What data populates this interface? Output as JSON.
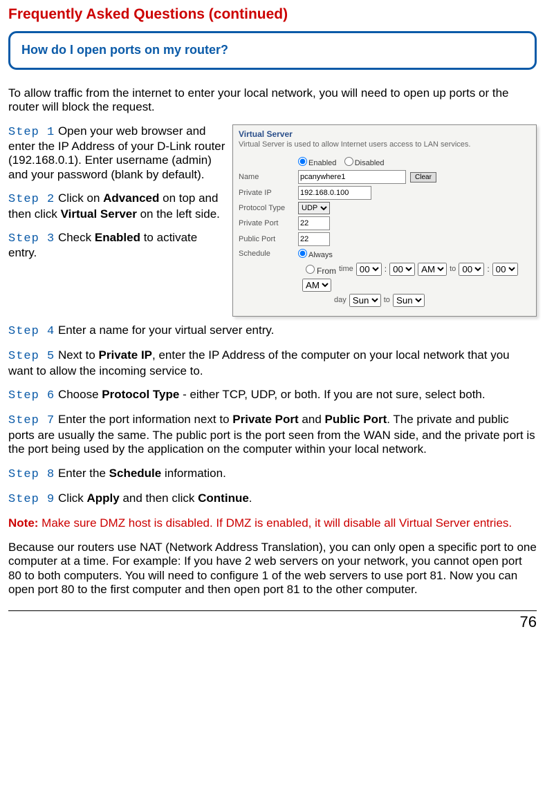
{
  "title": "Frequently Asked Questions (continued)",
  "question": "How do I open ports on my router?",
  "intro": "To allow traffic from the internet to enter your local network, you will need to open up ports or the router will block the request.",
  "steps": {
    "s1": {
      "label": "Step 1",
      "before": " Open your web browser and enter the IP Address of your D-Link router (192.168.0.1). Enter username (admin) and your password (blank by default)."
    },
    "s2": {
      "label": "Step 2",
      "t1": " Click on ",
      "b1": "Advanced",
      "t2": " on top and then click ",
      "b2": "Virtual Server",
      "t3": " on the left side."
    },
    "s3": {
      "label": "Step 3",
      "t1": " Check ",
      "b1": "Enabled",
      "t2": " to activate entry."
    },
    "s4": {
      "label": "Step 4",
      "t1": " Enter a name for your virtual server entry."
    },
    "s5": {
      "label": "Step 5",
      "t1": " Next to ",
      "b1": "Private IP",
      "t2": ", enter the IP Address of the computer on your local network that you want to allow the incoming service to."
    },
    "s6": {
      "label": "Step 6",
      "t1": " Choose ",
      "b1": "Protocol Type",
      "t2": " - either TCP, UDP, or both. If you are not sure, select both."
    },
    "s7": {
      "label": "Step 7",
      "t1": " Enter the port information next to ",
      "b1": "Private Port",
      "t2": " and ",
      "b2": "Public Port",
      "t3": ". The private and public ports are usually the same. The public port is the port seen from the WAN side, and the private port is the port being used by the application on the computer within your local network."
    },
    "s8": {
      "label": "Step 8",
      "t1": " Enter the ",
      "b1": "Schedule",
      "t2": " information."
    },
    "s9": {
      "label": "Step 9",
      "t1": " Click ",
      "b1": "Apply",
      "t2": " and then click ",
      "b2": "Continue",
      "t3": "."
    }
  },
  "note": {
    "label": "Note:",
    "body": " Make sure DMZ host is disabled. If DMZ is enabled, it will disable all Virtual Server entries."
  },
  "closing": "Because our routers use NAT (Network Address Translation), you can only open a specific port to one computer at a time. For example: If you have 2 web servers on your network, you cannot open port 80 to both computers. You will need to configure 1 of the web servers to use port 81. Now you can open port 80 to the first computer and then open port 81 to the other computer.",
  "page_number": "76",
  "screenshot": {
    "title": "Virtual Server",
    "subtitle": "Virtual Server is used to allow Internet users access to LAN services.",
    "enabled_label": "Enabled",
    "disabled_label": "Disabled",
    "name_label": "Name",
    "name_value": "pcanywhere1",
    "clear_btn": "Clear",
    "private_ip_label": "Private IP",
    "private_ip_value": "192.168.0.100",
    "protocol_label": "Protocol Type",
    "protocol_value": "UDP",
    "private_port_label": "Private Port",
    "private_port_value": "22",
    "public_port_label": "Public Port",
    "public_port_value": "22",
    "schedule_label": "Schedule",
    "always_label": "Always",
    "from_label": "From",
    "time_label": "time",
    "to_label": "to",
    "day_label": "day",
    "hour": "00",
    "min": "00",
    "ampm": "AM",
    "dow": "Sun"
  }
}
